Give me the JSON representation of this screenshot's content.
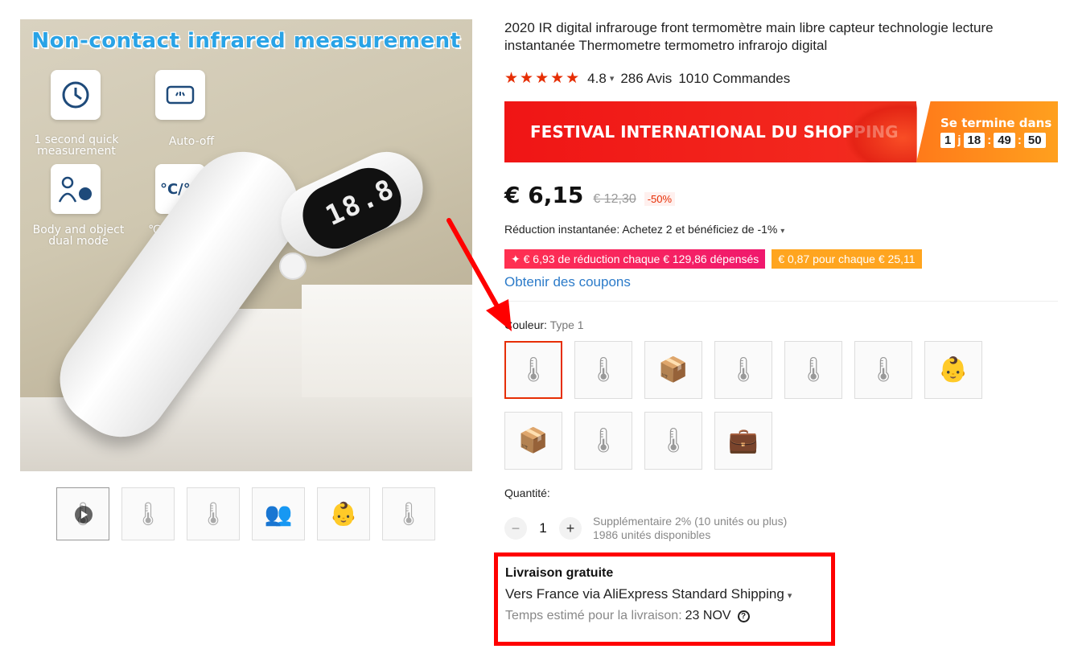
{
  "main_image": {
    "headline": "Non-contact infrared measurement",
    "features": [
      {
        "label": "1 second quick measurement",
        "icon": "clock-icon"
      },
      {
        "label": "Auto-off",
        "icon": "display-icon"
      },
      {
        "label": "Body and object dual mode",
        "icon": "person-object-icon"
      },
      {
        "label": "℃ / ℉ switch",
        "icon": "celsius-fahrenheit-icon"
      }
    ],
    "device_icon": "thermometer-icon"
  },
  "thumbnails": [
    {
      "icon": "thermometer-video-icon",
      "active": true
    },
    {
      "icon": "thermometer-icon"
    },
    {
      "icon": "thermometer-icon"
    },
    {
      "icon": "usage-illustration-icon"
    },
    {
      "icon": "baby-thermometer-icon"
    },
    {
      "icon": "thermometer-colors-icon"
    }
  ],
  "product": {
    "title": "2020 IR digital infrarouge front termomètre main libre capteur technologie lecture instantanée Thermometre termometro infrarojo digital",
    "rating": "4.8",
    "reviews": "286 Avis",
    "orders": "1010 Commandes"
  },
  "banner": {
    "title": "FESTIVAL INTERNATIONAL DU SHOPPING",
    "ends_label": "Se termine dans",
    "days": "1",
    "days_unit": "j",
    "hours": "18",
    "minutes": "49",
    "seconds": "50",
    "colors": {
      "left": "#f01515",
      "right": "#ffa01e"
    }
  },
  "price": {
    "current": "€ 6,15",
    "original": "€ 12,30",
    "discount": "-50%"
  },
  "instant_reduction": "Réduction instantanée: Achetez 2 et bénéficiez de -1%",
  "coupons": [
    "✦ € 6,93 de réduction chaque € 129,86 dépensés",
    "€ 0,87 pour chaque € 25,11"
  ],
  "get_coupons": "Obtenir des coupons",
  "color": {
    "label": "Couleur:",
    "value": "Type 1",
    "swatches": [
      {
        "icon": "thermometer-icon",
        "selected": true
      },
      {
        "icon": "thermometer-colors-icon"
      },
      {
        "icon": "boxed-thermometer-icon"
      },
      {
        "icon": "thermometer-measure-icon"
      },
      {
        "icon": "thermometer-colors-icon"
      },
      {
        "icon": "thermometer-stand-icon"
      },
      {
        "icon": "baby-thermometer-icon"
      },
      {
        "icon": "boxed-thermometer-icon"
      },
      {
        "icon": "thermometer-icon"
      },
      {
        "icon": "thermometer-colors-icon"
      },
      {
        "icon": "thermometer-case-icon"
      }
    ]
  },
  "quantity": {
    "label": "Quantité:",
    "value": "1",
    "extra": "Supplémentaire 2% (10 unités ou plus)",
    "available": "1986 unités disponibles"
  },
  "shipping": {
    "title": "Livraison gratuite",
    "via": "Vers France via AliExpress Standard Shipping",
    "estimate_label": "Temps estimé pour la livraison:",
    "estimate_date": "23 NOV"
  },
  "accent_color": "#e62e04",
  "annotation_color": "#ff0000"
}
